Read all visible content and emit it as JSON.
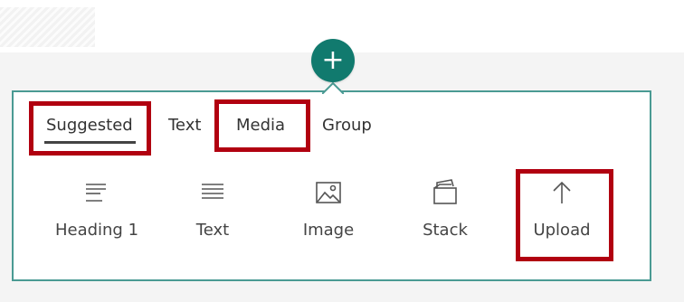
{
  "panel": {
    "tabs": [
      {
        "label": "Suggested",
        "selected": true
      },
      {
        "label": "Text"
      },
      {
        "label": "Media"
      },
      {
        "label": "Group"
      }
    ],
    "tools": [
      {
        "label": "Heading 1",
        "icon": "heading-icon"
      },
      {
        "label": "Text",
        "icon": "text-lines-icon"
      },
      {
        "label": "Image",
        "icon": "image-icon"
      },
      {
        "label": "Stack",
        "icon": "stack-icon"
      },
      {
        "label": "Upload",
        "icon": "upload-arrow-icon"
      }
    ]
  },
  "add_button": {
    "icon": "plus-icon"
  },
  "colors": {
    "accent": "#117a6e",
    "panel_border": "#4a9a93",
    "highlight_red": "#b10010"
  }
}
